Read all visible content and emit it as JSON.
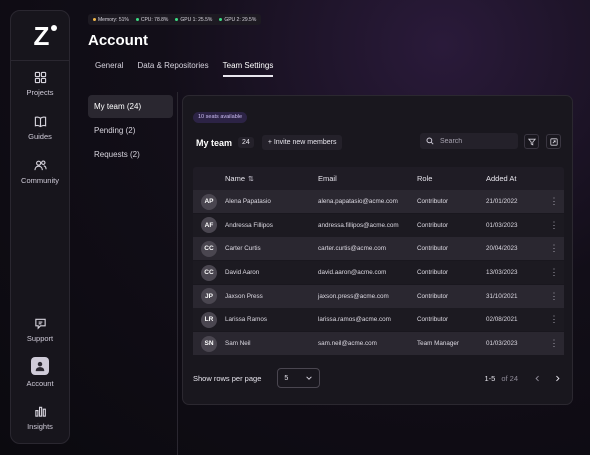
{
  "status": {
    "items": [
      {
        "label": "Memory: 51%",
        "color": "#f2b84b"
      },
      {
        "label": "CPU: 78.8%",
        "color": "#3ddc84"
      },
      {
        "label": "GPU 1: 25.5%",
        "color": "#3ddc84"
      },
      {
        "label": "GPU 2: 29.5%",
        "color": "#3ddc84"
      }
    ]
  },
  "sidebar": {
    "logo_letter": "Z",
    "items": [
      {
        "label": "Projects",
        "icon": "grid-icon"
      },
      {
        "label": "Guides",
        "icon": "book-icon"
      },
      {
        "label": "Community",
        "icon": "users-icon"
      },
      {
        "label": "Support",
        "icon": "chat-icon"
      },
      {
        "label": "Account",
        "icon": "account-icon"
      },
      {
        "label": "Insights",
        "icon": "bar-chart-icon"
      }
    ]
  },
  "header": {
    "title": "Account",
    "tabs": [
      {
        "label": "General"
      },
      {
        "label": "Data & Repositories"
      },
      {
        "label": "Team Settings"
      }
    ]
  },
  "subnav": [
    {
      "label": "My team (24)"
    },
    {
      "label": "Pending (2)"
    },
    {
      "label": "Requests (2)"
    }
  ],
  "panel": {
    "seats_badge": "10 seats available",
    "title": "My team",
    "count": "24",
    "invite_label": "+ Invite new members",
    "search_placeholder": "Search"
  },
  "table": {
    "columns": {
      "name": "Name",
      "sort_glyph": "⇅",
      "email": "Email",
      "role": "Role",
      "added": "Added At"
    },
    "menu_glyph": "⋮",
    "rows": [
      {
        "initials": "AP",
        "name": "Alena Papatasio",
        "email": "alena.papatasio@acme.com",
        "role": "Contributor",
        "added": "21/01/2022"
      },
      {
        "initials": "AF",
        "name": "Andressa Fillipos",
        "email": "andressa.fillipos@acme.com",
        "role": "Contributor",
        "added": "01/03/2023"
      },
      {
        "initials": "CC",
        "name": "Carter Curtis",
        "email": "carter.curtis@acme.com",
        "role": "Contributor",
        "added": "20/04/2023"
      },
      {
        "initials": "CC",
        "name": "David Aaron",
        "email": "david.aaron@acme.com",
        "role": "Contributor",
        "added": "13/03/2023"
      },
      {
        "initials": "JP",
        "name": "Jaxson Press",
        "email": "jaxson.press@acme.com",
        "role": "Contributor",
        "added": "31/10/2021"
      },
      {
        "initials": "LR",
        "name": "Larissa Ramos",
        "email": "larissa.ramos@acme.com",
        "role": "Contributor",
        "added": "02/08/2021"
      },
      {
        "initials": "SN",
        "name": "Sam Neil",
        "email": "sam.neil@acme.com",
        "role": "Team Manager",
        "added": "01/03/2023"
      }
    ]
  },
  "pagination": {
    "rows_label": "Show rows per page",
    "rows_value": "5",
    "range": "1-5",
    "of_label": "of 24"
  }
}
